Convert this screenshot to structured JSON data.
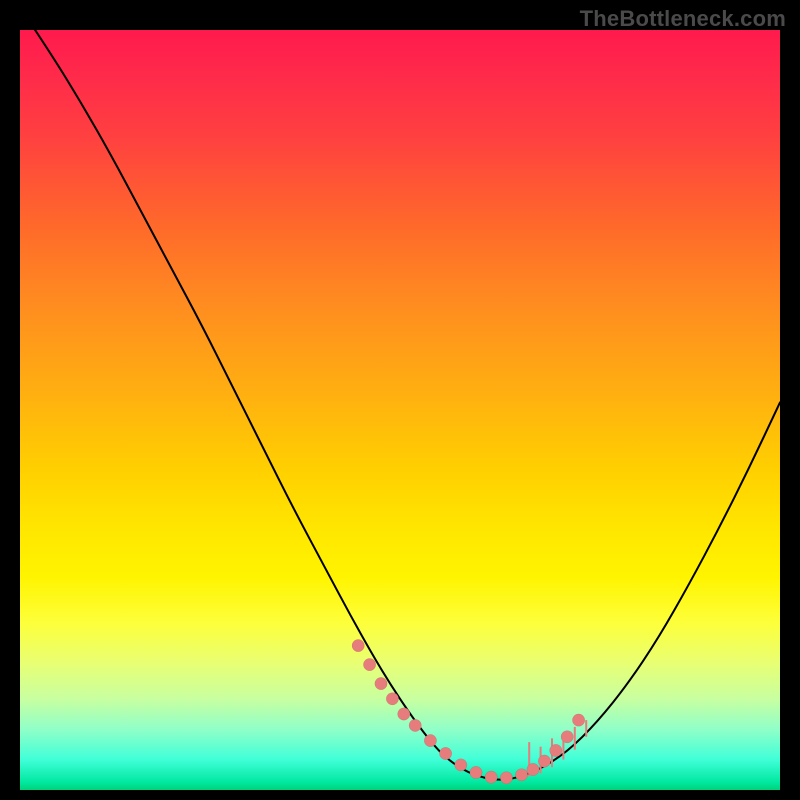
{
  "watermark": "TheBottleneck.com",
  "colors": {
    "gradient_top": "#ff1a4d",
    "gradient_bottom": "#00d27a",
    "curve": "#000000",
    "dots": "#e77c7c",
    "background": "#000000"
  },
  "chart_data": {
    "type": "line",
    "title": "",
    "xlabel": "",
    "ylabel": "",
    "xlim": [
      0,
      100
    ],
    "ylim": [
      0,
      100
    ],
    "grid": false,
    "legend": false,
    "series": [
      {
        "name": "bottleneck-curve",
        "x": [
          0,
          4,
          8,
          12,
          16,
          20,
          24,
          28,
          32,
          36,
          40,
          44,
          48,
          52,
          55,
          57,
          59,
          61,
          63,
          65,
          68,
          72,
          76,
          80,
          84,
          88,
          92,
          96,
          100
        ],
        "y": [
          103,
          97,
          90.5,
          83.5,
          76,
          68.5,
          61,
          53,
          45,
          37,
          29.5,
          22,
          15,
          9,
          5.2,
          3.5,
          2.3,
          1.6,
          1.3,
          1.5,
          2.5,
          5,
          9,
          14,
          20,
          27,
          34.5,
          42.5,
          51
        ]
      }
    ],
    "dots": {
      "x": [
        44.5,
        46,
        47.5,
        49,
        50.5,
        52,
        54,
        56,
        58,
        60,
        62,
        64,
        66,
        67.5,
        69,
        70.5,
        72,
        73.5
      ],
      "y": [
        19,
        16.5,
        14,
        12,
        10,
        8.5,
        6.5,
        4.8,
        3.3,
        2.3,
        1.7,
        1.6,
        2.0,
        2.7,
        3.8,
        5.2,
        7.0,
        9.2
      ]
    },
    "ticks_up": {
      "x": [
        67,
        68.5,
        70,
        71.5,
        73,
        74.5
      ],
      "y": [
        1.8,
        2.2,
        3.0,
        4.0,
        5.3,
        7.0
      ],
      "len": [
        4.5,
        3.5,
        3.8,
        2.8,
        3.0,
        2.2
      ]
    }
  }
}
